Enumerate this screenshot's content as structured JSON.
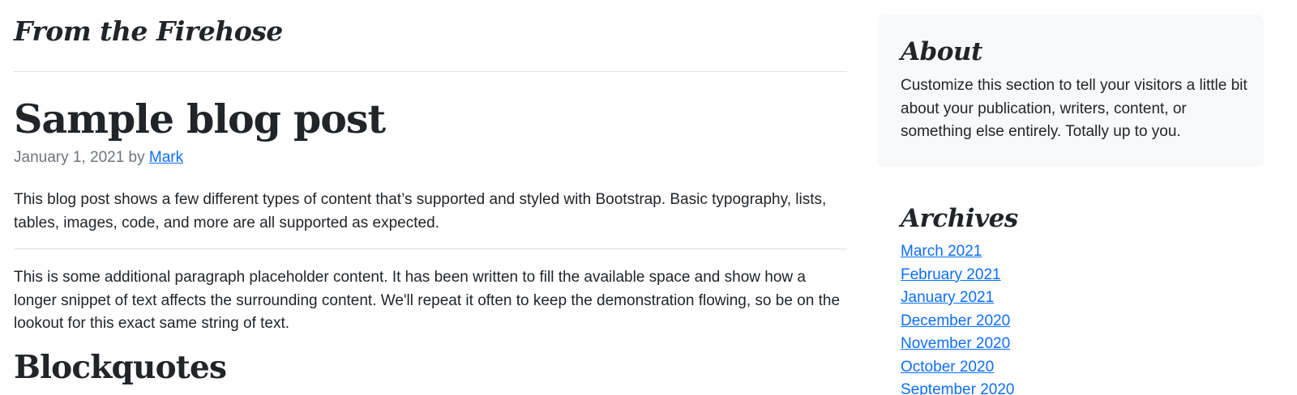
{
  "main": {
    "section_heading": "From the Firehose",
    "post": {
      "title": "Sample blog post",
      "meta_prefix": "January 1, 2021 by ",
      "author": "Mark",
      "intro": "This blog post shows a few different types of content that’s supported and styled with Bootstrap. Basic typography, lists, tables, images, code, and more are all supported as expected.",
      "paragraph": "This is some additional paragraph placeholder content. It has been written to fill the available space and show how a longer snippet of text affects the surrounding content. We'll repeat it often to keep the demonstration flowing, so be on the lookout for this exact same string of text.",
      "subheading": "Blockquotes"
    }
  },
  "sidebar": {
    "about": {
      "title": "About",
      "text": "Customize this section to tell your visitors a little bit about your publication, writers, content, or something else entirely. Totally up to you."
    },
    "archives": {
      "title": "Archives",
      "items": [
        "March 2021",
        "February 2021",
        "January 2021",
        "December 2020",
        "November 2020",
        "October 2020",
        "September 2020"
      ]
    }
  },
  "colors": {
    "text": "#212529",
    "muted": "#6c757d",
    "link": "#0d6efd",
    "sidebar_box": "#f8f9fa",
    "rule": "#dcdfe3"
  }
}
